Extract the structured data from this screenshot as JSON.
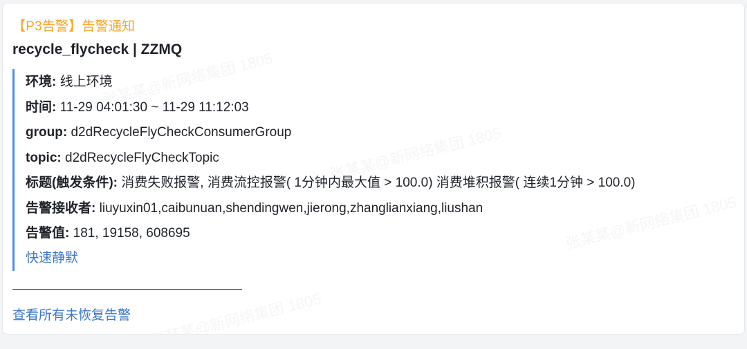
{
  "alert": {
    "tag": "【P3告警】告警通知",
    "title": "recycle_flycheck | ZZMQ",
    "fields": [
      {
        "key": "环境",
        "value": "线上环境"
      },
      {
        "key": "时间",
        "value": "11-29 04:01:30 ~ 11-29 11:12:03"
      },
      {
        "key": "group",
        "value": "d2dRecycleFlyCheckConsumerGroup"
      },
      {
        "key": "topic",
        "value": "d2dRecycleFlyCheckTopic"
      },
      {
        "key": "标题(触发条件)",
        "value": "消费失败报警, 消费流控报警( 1分钟内最大值 > 100.0) 消费堆积报警( 连续1分钟 > 100.0)"
      },
      {
        "key": "告警接收者",
        "value": "liuyuxin01,caibunuan,shendingwen,jierong,zhanglianxiang,liushan"
      },
      {
        "key": "告警值",
        "value": "181, 19158, 608695"
      }
    ],
    "silence_link": "快速静默",
    "view_all_link": "查看所有未恢复告警"
  },
  "watermark": "张某某@新网络集团 1805",
  "colors": {
    "tag": "#f5a623",
    "link": "#3e78c9",
    "accent_bar": "#4c8bf5"
  }
}
